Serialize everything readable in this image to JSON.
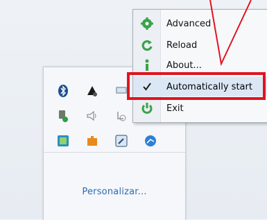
{
  "menu": {
    "items": [
      {
        "label": "Advanced",
        "icon": "gear-icon"
      },
      {
        "label": "Reload",
        "icon": "reload-icon"
      },
      {
        "label": "About...",
        "icon": "info-icon"
      },
      {
        "label": "Automatically start",
        "icon": "checkmark-icon",
        "checked": true
      },
      {
        "label": "Exit",
        "icon": "power-icon"
      }
    ]
  },
  "tray": {
    "icons": [
      "bluetooth-icon",
      "network-icon",
      "display-icon",
      "usb-device-icon",
      "speaker-icon",
      "sync-icon",
      "app-icon",
      "puzzle-icon",
      "wrench-icon",
      "browser-icon"
    ],
    "customize_link": "Personalizar..."
  },
  "colors": {
    "highlight_border": "#e0131f",
    "menu_hover": "#dce7f6",
    "link": "#2b6cb0"
  }
}
